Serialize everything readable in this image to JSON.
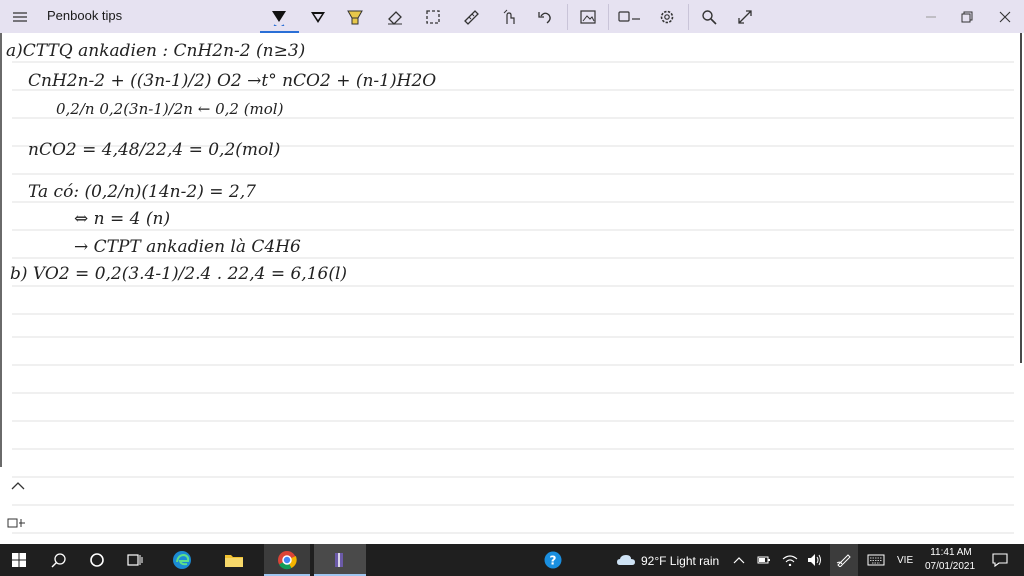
{
  "window": {
    "title": "Penbook tips"
  },
  "toolbar": {
    "icons": [
      "menu-icon",
      "pen-icon",
      "pen-outline-icon",
      "highlighter-icon",
      "eraser-icon",
      "lasso-select-icon",
      "ruler-icon",
      "touch-write-icon",
      "undo-icon",
      "insert-image-icon",
      "shape-icon",
      "settings-icon",
      "search-icon",
      "expand-icon",
      "minimize-icon",
      "maximize-icon",
      "close-icon"
    ],
    "highlighter_color": "#e8c84a",
    "accent": "#2a6fd6"
  },
  "notes": {
    "lines": [
      "a)CTTQ ankadien : CnH2n-2 (n≥3)",
      "CnH2n-2 + ((3n-1)/2) O2 →t° nCO2 + (n-1)H2O",
      "0,2/n   0,2(3n-1)/2n ←   0,2   (mol)",
      "nCO2 = 4,48/22,4 = 0,2(mol)",
      "Ta có: (0,2/n)(14n-2) = 2,7",
      "⇔ n = 4 (n)",
      "→ CTPT ankadien là C4H6",
      "b) VO2 = 0,2(3.4-1)/2.4 . 22,4 = 6,16(l)"
    ]
  },
  "taskbar": {
    "weather": "92°F  Light rain",
    "language": "VIE",
    "time": "11:41 AM",
    "date": "07/01/2021"
  }
}
